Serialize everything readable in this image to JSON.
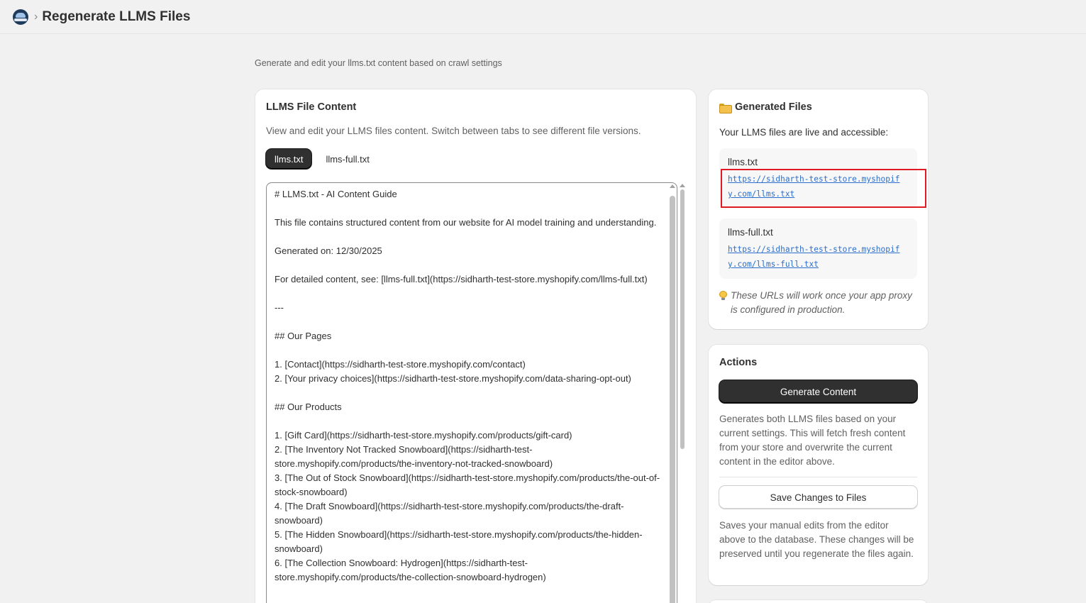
{
  "header": {
    "breadcrumb_sep": "›",
    "title": "Regenerate LLMS Files"
  },
  "subtitle": "Generate and edit your llms.txt content based on crawl settings",
  "content_card": {
    "title": "LLMS File Content",
    "description": "View and edit your LLMS files content. Switch between tabs to see different file versions.",
    "tabs": [
      {
        "label": "llms.txt",
        "active": true
      },
      {
        "label": "llms-full.txt",
        "active": false
      }
    ],
    "editor_text": "# LLMS.txt - AI Content Guide\n\nThis file contains structured content from our website for AI model training and understanding.\n\nGenerated on: 12/30/2025\n\nFor detailed content, see: [llms-full.txt](https://sidharth-test-store.myshopify.com/llms-full.txt)\n\n---\n\n## Our Pages\n\n1. [Contact](https://sidharth-test-store.myshopify.com/contact)\n2. [Your privacy choices](https://sidharth-test-store.myshopify.com/data-sharing-opt-out)\n\n## Our Products\n\n1. [Gift Card](https://sidharth-test-store.myshopify.com/products/gift-card)\n2. [The Inventory Not Tracked Snowboard](https://sidharth-test-store.myshopify.com/products/the-inventory-not-tracked-snowboard)\n3. [The Out of Stock Snowboard](https://sidharth-test-store.myshopify.com/products/the-out-of-stock-snowboard)\n4. [The Draft Snowboard](https://sidharth-test-store.myshopify.com/products/the-draft-snowboard)\n5. [The Hidden Snowboard](https://sidharth-test-store.myshopify.com/products/the-hidden-snowboard)\n6. [The Collection Snowboard: Hydrogen](https://sidharth-test-store.myshopify.com/products/the-collection-snowboard-hydrogen)"
  },
  "files_card": {
    "title": "Generated Files",
    "description": "Your LLMS files are live and accessible:",
    "files": [
      {
        "name": "llms.txt",
        "url": "https://sidharth-test-store.myshopify.com/llms.txt"
      },
      {
        "name": "llms-full.txt",
        "url": "https://sidharth-test-store.myshopify.com/llms-full.txt"
      }
    ],
    "hint": "These URLs will work once your app proxy is configured in production."
  },
  "actions_card": {
    "title": "Actions",
    "generate_label": "Generate Content",
    "generate_desc": "Generates both LLMS files based on your current settings. This will fetch fresh content from your store and overwrite the current content in the editor above.",
    "save_label": "Save Changes to Files",
    "save_desc": "Saves your manual edits from the editor above to the database. These changes will be preserved until you regenerate the files again."
  },
  "colors": {
    "accent_dark": "#303030",
    "link": "#2c6ecb",
    "highlight": "#e01b24"
  }
}
